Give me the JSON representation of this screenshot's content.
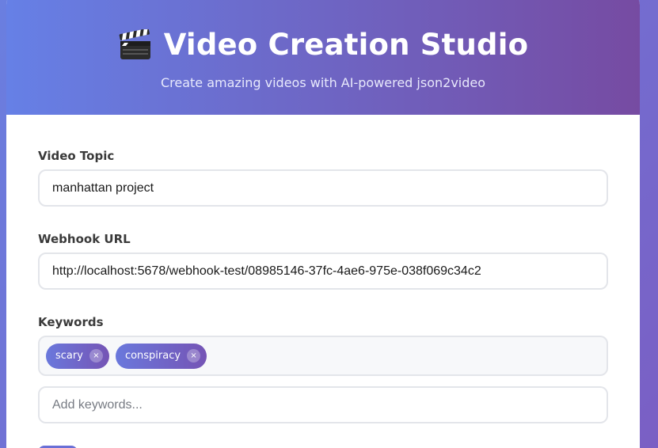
{
  "header": {
    "title": "Video Creation Studio",
    "subtitle": "Create amazing videos with AI-powered json2video"
  },
  "form": {
    "topic": {
      "label": "Video Topic",
      "value": "manhattan project"
    },
    "webhook": {
      "label": "Webhook URL",
      "value": "http://localhost:5678/webhook-test/08985146-37fc-4ae6-975e-038f069c34c2"
    },
    "keywords": {
      "label": "Keywords",
      "tags": [
        {
          "label": "scary",
          "remove": "×"
        },
        {
          "label": "conspiracy",
          "remove": "×"
        }
      ],
      "input_placeholder": "Add keywords..."
    }
  },
  "colors": {
    "header_start": "#6680e6",
    "header_end": "#764ba2",
    "tag_start": "#6a78dc",
    "tag_end": "#7554b5"
  },
  "icons": {
    "title_icon": "clapperboard-icon"
  }
}
